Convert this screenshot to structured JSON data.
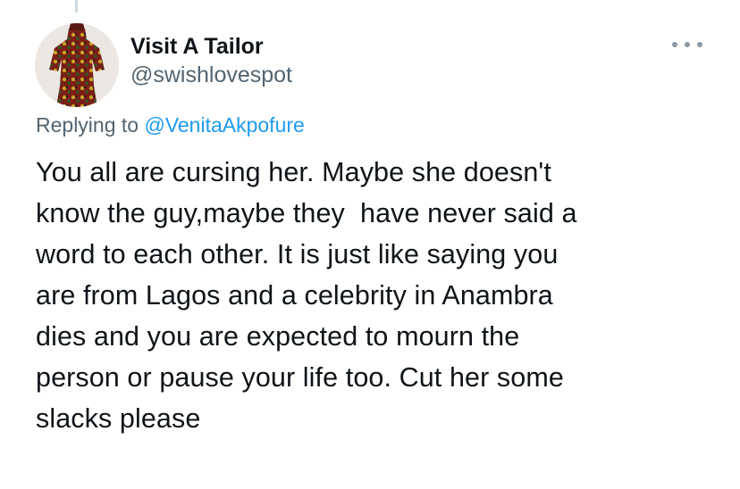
{
  "tweet": {
    "author_name": "Visit A Tailor",
    "author_handle": "@swishlovespot",
    "avatar_icon": "avatar-photo",
    "more_icon": "more-options-icon",
    "replying_prefix": "Replying to ",
    "replying_to": "@VenitaAkpofure",
    "text_lines": [
      "You all are cursing her. Maybe she doesn't",
      "know the guy,maybe they  have never said a",
      "word to each other. It is just like saying you",
      "are from Lagos and a celebrity in Anambra",
      "dies and you are expected to mourn the",
      "person or pause your life too. Cut her some",
      "slacks please"
    ]
  },
  "colors": {
    "text": "#0f1419",
    "secondary": "#536471",
    "link": "#1d9bf0",
    "thread_line": "#cfd9de"
  }
}
